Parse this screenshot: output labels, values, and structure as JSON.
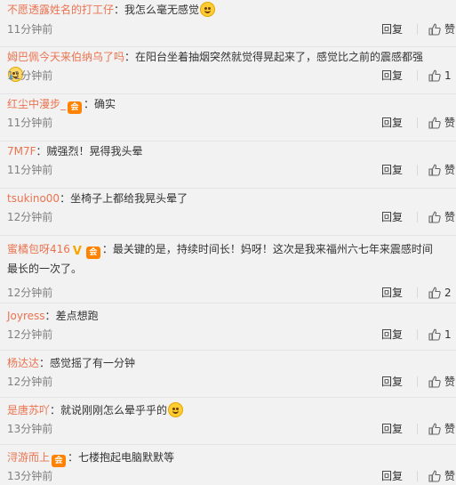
{
  "comments": [
    {
      "user": "不愿透露姓名的打工仔",
      "badges": [],
      "content": "我怎么毫无感觉",
      "emoji": "laugh",
      "time": "11分钟前",
      "like": "赞"
    },
    {
      "user": "姆巴佩今天来伯纳乌了吗",
      "badges": [],
      "content": "在阳台坐着抽烟突然就觉得晃起来了，感觉比之前的震感都强",
      "emoji": "cry",
      "time": "11分钟前",
      "like": "1"
    },
    {
      "user": "红尘中漫步_",
      "badges": [
        "vip"
      ],
      "content": "确实",
      "emoji": "",
      "time": "11分钟前",
      "like": "赞"
    },
    {
      "user": "7M7F",
      "badges": [],
      "content": "贼强烈！晃得我头晕",
      "emoji": "",
      "time": "11分钟前",
      "like": "赞"
    },
    {
      "user": "tsukino00",
      "badges": [],
      "content": "坐椅子上都给我晃头晕了",
      "emoji": "",
      "time": "12分钟前",
      "like": "赞"
    },
    {
      "user": "蜜橘包呀416",
      "badges": [
        "v",
        "vip"
      ],
      "content": "最关键的是，持续时间长！妈呀！这次是我来福州六七年来震感时间最长的一次了。",
      "emoji": "",
      "time": "12分钟前",
      "like": "2"
    },
    {
      "user": "Joyress",
      "badges": [],
      "content": "差点想跑",
      "emoji": "",
      "time": "12分钟前",
      "like": "1"
    },
    {
      "user": "杨达达",
      "badges": [],
      "content": "感觉摇了有一分钟",
      "emoji": "",
      "time": "12分钟前",
      "like": "赞"
    },
    {
      "user": "是唐苏吖",
      "badges": [],
      "content": "就说刚刚怎么晕乎乎的",
      "emoji": "laugh",
      "time": "13分钟前",
      "like": "赞"
    },
    {
      "user": "浔游而上",
      "badges": [
        "vip"
      ],
      "content": "七楼抱起电脑默默等",
      "emoji": "",
      "time": "13分钟前",
      "like": "赞"
    }
  ],
  "ui": {
    "reply_label": "回复",
    "separator": "："
  },
  "colors": {
    "username": "#eb7350",
    "meta": "#808080",
    "background": "#f2f2f2"
  }
}
